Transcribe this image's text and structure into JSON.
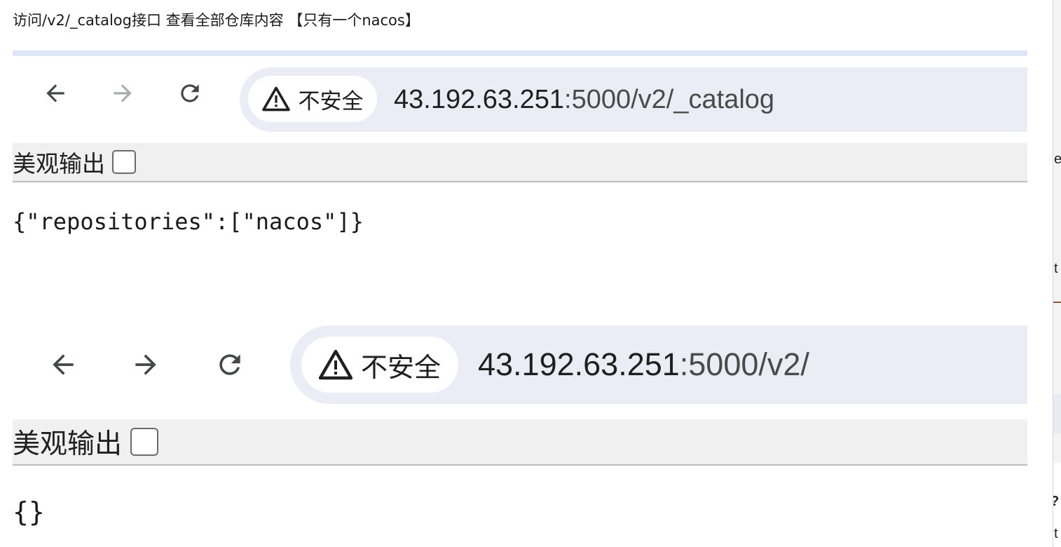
{
  "caption": "访问/v2/_catalog接口 查看全部仓库内容 【只有一个nacos】",
  "browser1": {
    "security_label": "不安全",
    "url_host": "43.192.63.251",
    "url_path": ":5000/v2/_catalog",
    "pretty_print_label": "美观输出",
    "response_body": "{\"repositories\":[\"nacos\"]}"
  },
  "browser2": {
    "security_label": "不安全",
    "url_host": "43.192.63.251",
    "url_path": ":5000/v2/",
    "pretty_print_label": "美观输出",
    "response_body": "{}"
  },
  "right_window_fragments": [
    "e",
    "t",
    "?",
    "t"
  ],
  "icons": {
    "back": "arrow-left-icon",
    "forward": "arrow-right-icon",
    "reload": "reload-icon",
    "warning": "warning-triangle-icon"
  },
  "colors": {
    "omnibox_bg": "#eaedf5",
    "pretty_bar_bg": "#f0f0f0",
    "forward_disabled": "#a9acb1",
    "icon": "#444746"
  }
}
